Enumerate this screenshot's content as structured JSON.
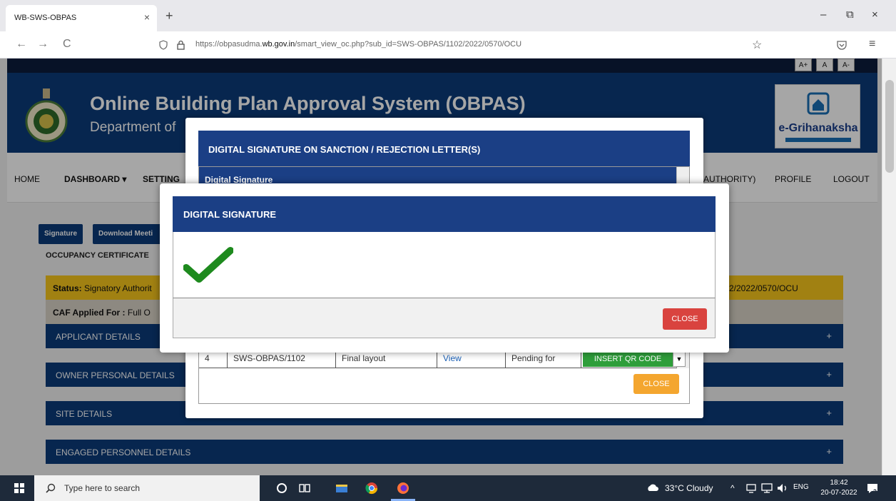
{
  "browser": {
    "tab_title": "WB-SWS-OBPAS",
    "tab_close": "×",
    "new_tab": "+",
    "url_prefix": "https://obpasudma.",
    "url_domain": "wb.gov.in",
    "url_rest": "/smart_view_oc.php?sub_id=SWS-OBPAS/1102/2022/0570/OCU",
    "back": "←",
    "forward": "→",
    "reload": "C",
    "star": "☆",
    "menu": "≡",
    "minimize": "–",
    "restore": "⧉",
    "close": "×"
  },
  "font_controls": [
    "A+",
    "A",
    "A-"
  ],
  "header": {
    "title": "Online Building Plan Approval System (OBPAS)",
    "subtitle": "Department of",
    "logo_text": "e-Grihanaksha"
  },
  "nav": {
    "home": "HOME",
    "dashboard": "DASHBOARD ▾",
    "setting": "SETTING",
    "authority": "AUTHORITY)",
    "profile": "PROFILE",
    "logout": "LOGOUT"
  },
  "page": {
    "signature_btn": "Signature",
    "download_btn": "Download Meeti",
    "occupancy_label": "OCCUPANCY CERTIFICATE",
    "status_label": "Status:",
    "status_value": " Signatory Authorit",
    "status_right": "2/2022/0570/OCU",
    "caf_label": "CAF Applied For :",
    "caf_value": " Full O",
    "sections": [
      "APPLICANT DETAILS",
      "OWNER PERSONAL DETAILS",
      "SITE DETAILS",
      "ENGAGED PERSONNEL DETAILS"
    ],
    "plus": "+"
  },
  "modal_back": {
    "title": "DIGITAL SIGNATURE ON SANCTION / REJECTION LETTER(S)",
    "inner_title": "Digital Signature",
    "row": {
      "num": "4",
      "id": "SWS-OBPAS/1102",
      "doc": "Final layout",
      "view": "View",
      "status": "Pending for",
      "action": "INSERT QR CODE"
    },
    "close_label": "CLOSE"
  },
  "modal_front": {
    "title": "DIGITAL SIGNATURE",
    "close_label": "CLOSE"
  },
  "taskbar": {
    "search_placeholder": "Type here to search",
    "weather": "33°C  Cloudy",
    "lang": "ENG",
    "time": "18:42",
    "date": "20-07-2022",
    "notif": "2"
  },
  "colors": {
    "navy": "#0b3b7a",
    "modal_header": "#1b3f85",
    "status_yellow": "#f7c71c",
    "success_green": "#1e8a1e",
    "close_red": "#d9433f",
    "close_orange": "#f4a62f"
  }
}
